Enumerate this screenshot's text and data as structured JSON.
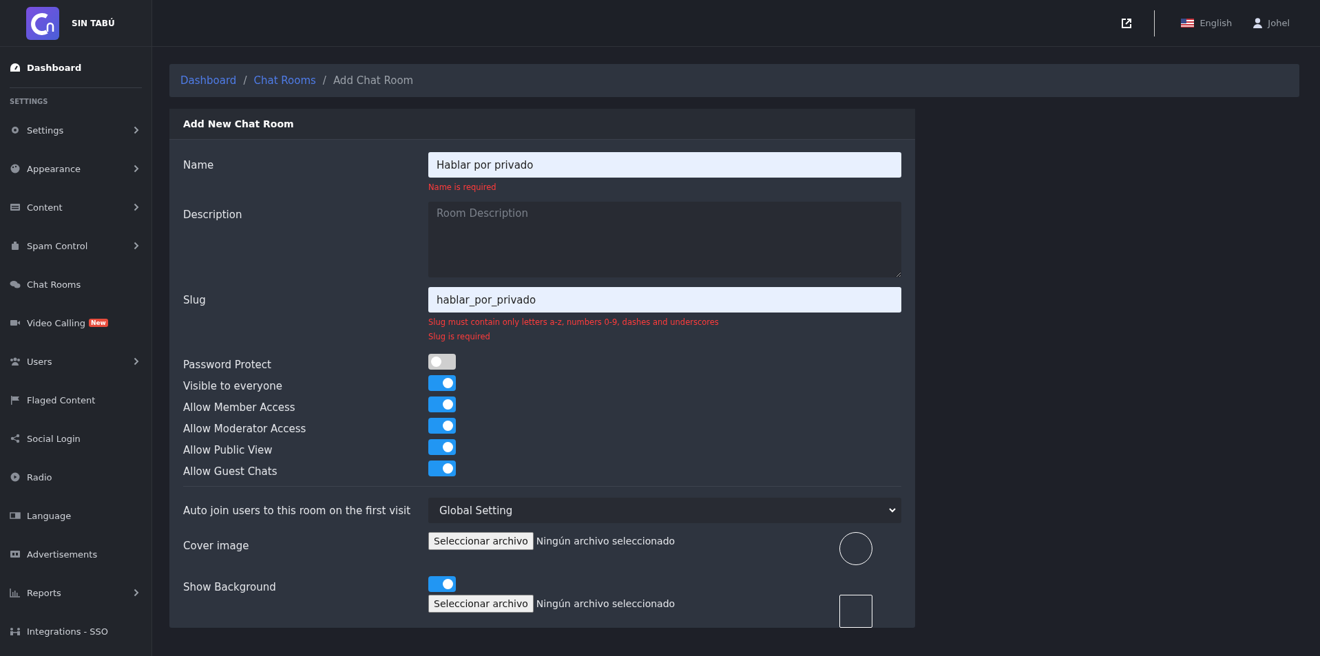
{
  "brand": {
    "name": "SIN TABÚ"
  },
  "topbar": {
    "language": "English",
    "user": "Johel"
  },
  "sidebar": {
    "top_item": {
      "label": "Dashboard"
    },
    "section": "SETTINGS",
    "items": [
      {
        "label": "Settings",
        "submenu": true
      },
      {
        "label": "Appearance",
        "submenu": true
      },
      {
        "label": "Content",
        "submenu": true
      },
      {
        "label": "Spam Control",
        "submenu": true
      },
      {
        "label": "Chat Rooms",
        "submenu": false
      },
      {
        "label": "Video Calling",
        "submenu": false,
        "badge": "New"
      },
      {
        "label": "Users",
        "submenu": true
      },
      {
        "label": "Flaged Content",
        "submenu": false
      },
      {
        "label": "Social Login",
        "submenu": false
      },
      {
        "label": "Radio",
        "submenu": false
      },
      {
        "label": "Language",
        "submenu": false
      },
      {
        "label": "Advertisements",
        "submenu": false
      },
      {
        "label": "Reports",
        "submenu": true
      },
      {
        "label": "Integrations - SSO",
        "submenu": false
      }
    ]
  },
  "breadcrumb": [
    {
      "kind": "item",
      "label": "Dashboard",
      "link": true
    },
    {
      "kind": "separator",
      "label": "/"
    },
    {
      "kind": "item",
      "label": "Chat Rooms",
      "link": true
    },
    {
      "kind": "separator",
      "label": "/"
    },
    {
      "kind": "item",
      "label": "Add Chat Room",
      "link": false
    }
  ],
  "form": {
    "title": "Add New Chat Room",
    "groups": [
      {
        "fields": [
          {
            "kind": "text",
            "label": "Name",
            "value": "Hablar por privado",
            "errors": [
              "Name is required"
            ]
          },
          {
            "kind": "textarea",
            "label": "Description",
            "placeholder": "Room Description"
          },
          {
            "kind": "text",
            "label": "Slug",
            "value": "hablar_por_privado",
            "errors": [
              "Slug must contain only letters a-z, numbers 0-9, dashes and underscores",
              "Slug is required"
            ]
          },
          {
            "kind": "toggle",
            "label": "Password Protect",
            "on": false
          },
          {
            "kind": "toggle",
            "label": "Visible to everyone",
            "on": true
          },
          {
            "kind": "toggle",
            "label": "Allow Member Access",
            "on": true
          },
          {
            "kind": "toggle",
            "label": "Allow Moderator Access",
            "on": true
          },
          {
            "kind": "toggle",
            "label": "Allow Public View",
            "on": true
          },
          {
            "kind": "toggle",
            "label": "Allow Guest Chats",
            "on": true
          }
        ]
      },
      {
        "fields": [
          {
            "kind": "select",
            "label": "Auto join users to this room on the first visit",
            "value": "Global Setting"
          },
          {
            "kind": "file",
            "label": "Cover image",
            "button": "Seleccionar archivo",
            "status": "Ningún archivo seleccionado"
          },
          {
            "kind": "toggle",
            "label": "Show Background",
            "on": true
          },
          {
            "kind": "file",
            "button": "Seleccionar archivo",
            "status": "Ningún archivo seleccionado"
          }
        ]
      }
    ]
  }
}
